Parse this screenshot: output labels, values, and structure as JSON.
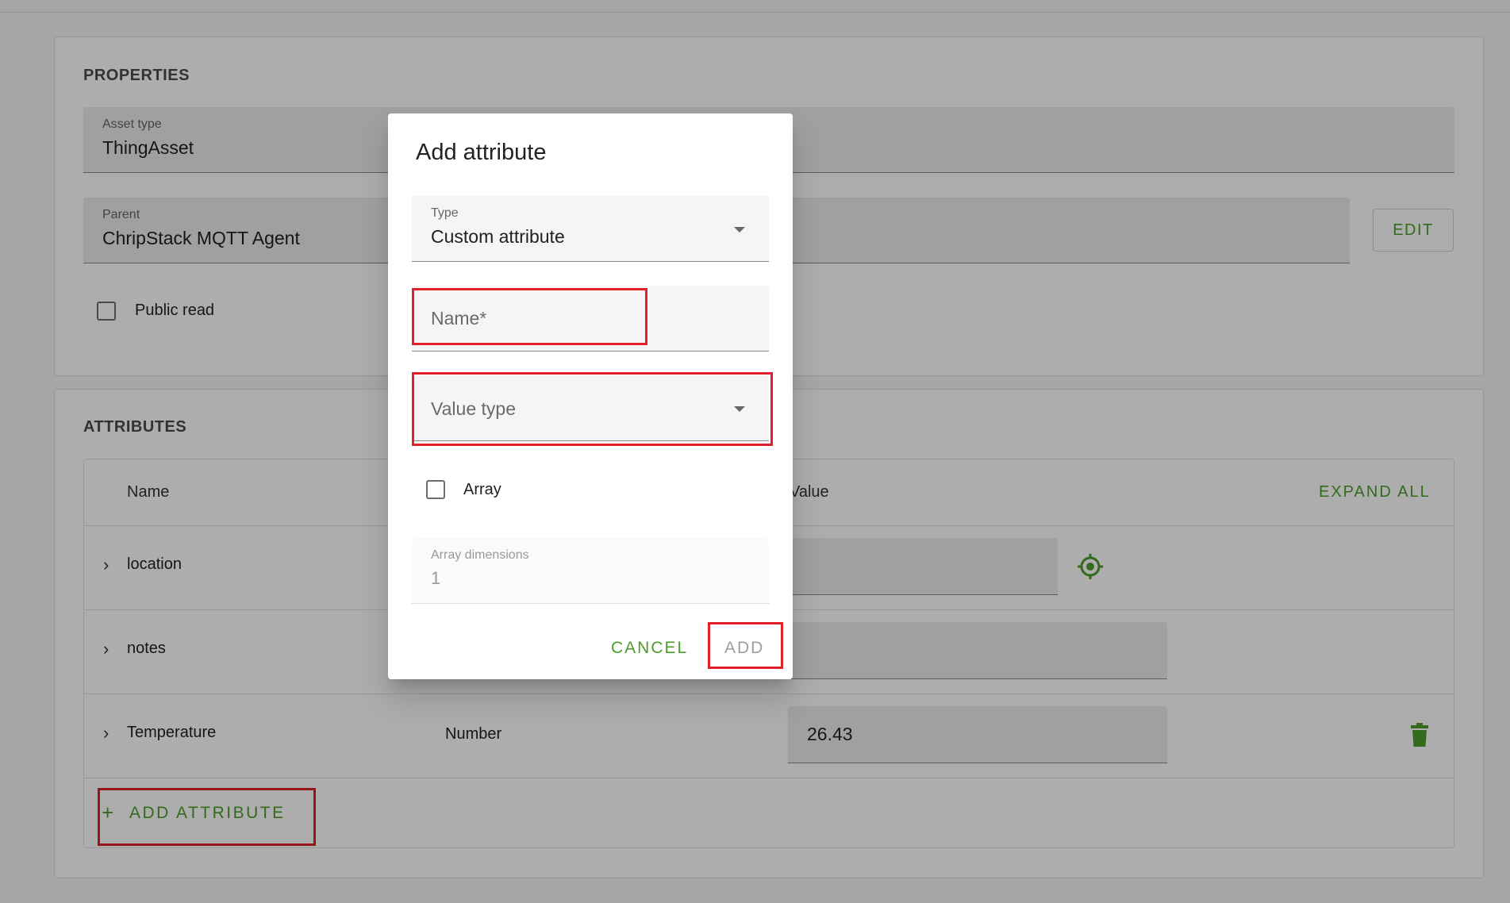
{
  "properties": {
    "title": "PROPERTIES",
    "asset_type": {
      "label": "Asset type",
      "value": "ThingAsset"
    },
    "parent": {
      "label": "Parent",
      "value": "ChripStack MQTT Agent"
    },
    "edit_label": "EDIT",
    "public_read_label": "Public read"
  },
  "attributes": {
    "title": "ATTRIBUTES",
    "headers": {
      "name": "Name",
      "value": "Value",
      "expand_all": "EXPAND ALL"
    },
    "rows": [
      {
        "name": "location",
        "type": "",
        "value": ""
      },
      {
        "name": "notes",
        "type": "",
        "value": ""
      },
      {
        "name": "Temperature",
        "type": "Number",
        "value": "26.43"
      }
    ],
    "add_attribute_label": "ADD ATTRIBUTE"
  },
  "dialog": {
    "title": "Add attribute",
    "type_label": "Type",
    "type_value": "Custom attribute",
    "name_placeholder": "Name*",
    "value_type_placeholder": "Value type",
    "array_label": "Array",
    "array_dimensions_label": "Array dimensions",
    "array_dimensions_value": "1",
    "cancel_label": "CANCEL",
    "add_label": "ADD"
  },
  "colors": {
    "accent": "#4c9d2a",
    "highlight": "#e0202b"
  },
  "icons": [
    "chevron-right-icon",
    "gps-target-icon",
    "trash-icon",
    "plus-icon",
    "dropdown-arrow-icon"
  ]
}
